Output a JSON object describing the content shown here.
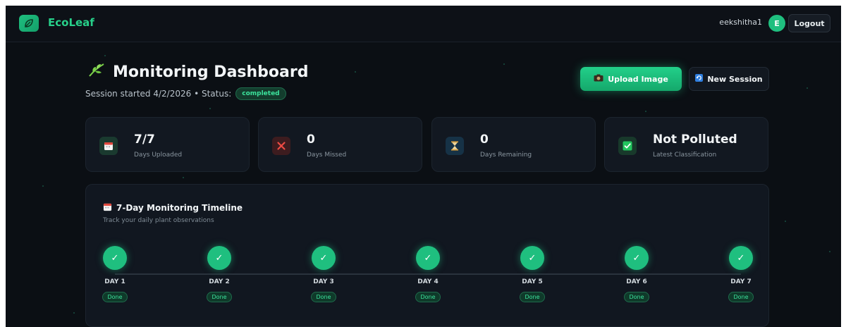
{
  "topbar": {
    "brand": "EcoLeaf",
    "logo_icon": "leaf-icon",
    "username": "eekshitha1",
    "avatar_initial": "E",
    "logout_label": "Logout"
  },
  "header": {
    "title": "Monitoring Dashboard",
    "title_icon": "herb-icon",
    "session_text": "Session started 4/2/2026 • Status:",
    "status_badge": "completed",
    "upload_label": "Upload Image",
    "upload_icon": "camera-icon",
    "new_session_label": "New Session",
    "new_session_icon": "refresh-icon"
  },
  "stats": [
    {
      "value": "7/7",
      "label": "Days Uploaded",
      "icon": "calendar-icon",
      "accent": "#1fbf7f"
    },
    {
      "value": "0",
      "label": "Days Missed",
      "icon": "cross-icon",
      "accent": "#e24b4b"
    },
    {
      "value": "0",
      "label": "Days Remaining",
      "icon": "hourglass-icon",
      "accent": "#3aa7e0"
    },
    {
      "value": "Not Polluted",
      "label": "Latest Classification",
      "icon": "checkbox-icon",
      "accent": "#22c55e"
    }
  ],
  "timeline": {
    "title": "7-Day Monitoring Timeline",
    "title_icon": "calendar-icon",
    "subtitle": "Track your daily plant observations",
    "days": [
      {
        "label": "DAY 1",
        "status": "Done"
      },
      {
        "label": "DAY 2",
        "status": "Done"
      },
      {
        "label": "DAY 3",
        "status": "Done"
      },
      {
        "label": "DAY 4",
        "status": "Done"
      },
      {
        "label": "DAY 5",
        "status": "Done"
      },
      {
        "label": "DAY 6",
        "status": "Done"
      },
      {
        "label": "DAY 7",
        "status": "Done"
      }
    ]
  },
  "colors": {
    "accent": "#1fbf7f",
    "background": "#0b0f14",
    "card": "#121821"
  }
}
